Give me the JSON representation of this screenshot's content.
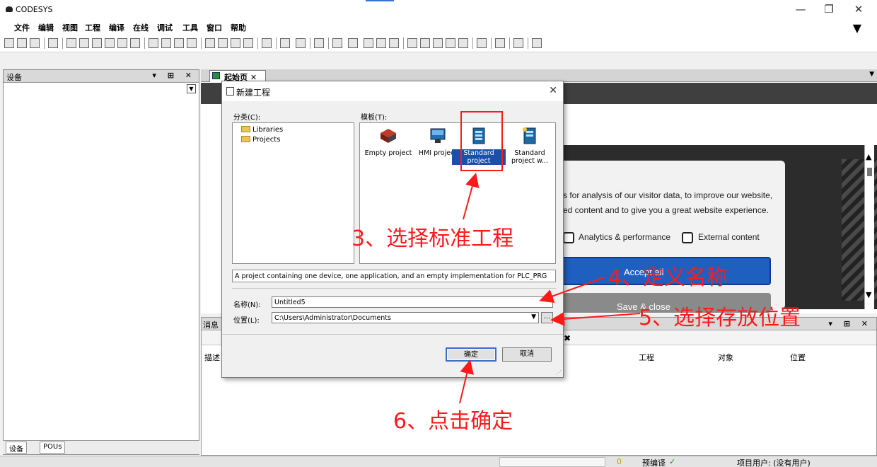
{
  "app": {
    "title": "CODESYS",
    "window_controls": {
      "minimize": "—",
      "restore": "❐",
      "close": "✕"
    }
  },
  "menu": [
    "文件",
    "编辑",
    "视图",
    "工程",
    "编译",
    "在线",
    "调试",
    "工具",
    "窗口",
    "帮助"
  ],
  "devices_panel": {
    "title": "设备",
    "controls": "▾ ⊞ ✕",
    "tabs": [
      "设备",
      "POUs"
    ]
  },
  "editor_tab": {
    "label": "起始页"
  },
  "website": {
    "cookie_text_1": "s for analysis of our visitor data, to improve our website,",
    "cookie_text_2": "ed content and to give you a great website experience.",
    "checkbox_analytics": "Analytics & performance",
    "checkbox_external": "External content",
    "accept_label": "Accept all",
    "save_label": "Save & close"
  },
  "messages_panel": {
    "title": "消息",
    "columns": [
      "描述",
      "工程",
      "对象",
      "位置"
    ]
  },
  "status_bar": {
    "precompile": "预编译",
    "precompile_check": "✓",
    "user": "项目用户: (没有用户)",
    "count": "0"
  },
  "dialog": {
    "title": "新建工程",
    "categories_label": "分类(C):",
    "categories": [
      "Libraries",
      "Projects"
    ],
    "templates_label": "模板(T):",
    "templates": [
      {
        "label": "Empty project",
        "icon": "empty-project-icon",
        "selected": false
      },
      {
        "label": "HMI project",
        "icon": "hmi-project-icon",
        "selected": false
      },
      {
        "label": "Standard project",
        "icon": "standard-project-icon",
        "selected": true
      },
      {
        "label": "Standard project w...",
        "icon": "standard-project-wizard-icon",
        "selected": false
      }
    ],
    "description": "A project containing one device, one application, and an empty implementation for PLC_PRG",
    "name_label": "名称(N):",
    "name_value": "Untitled5",
    "location_label": "位置(L):",
    "location_value": "C:\\Users\\Administrator\\Documents",
    "browse_label": "...",
    "ok_label": "确定",
    "cancel_label": "取消"
  },
  "annotations": {
    "step3": "3、选择标准工程",
    "step4": "4、定义名称",
    "step5": "5、选择存放位置",
    "step6": "6、点击确定",
    "color": "#ff1a1a"
  }
}
